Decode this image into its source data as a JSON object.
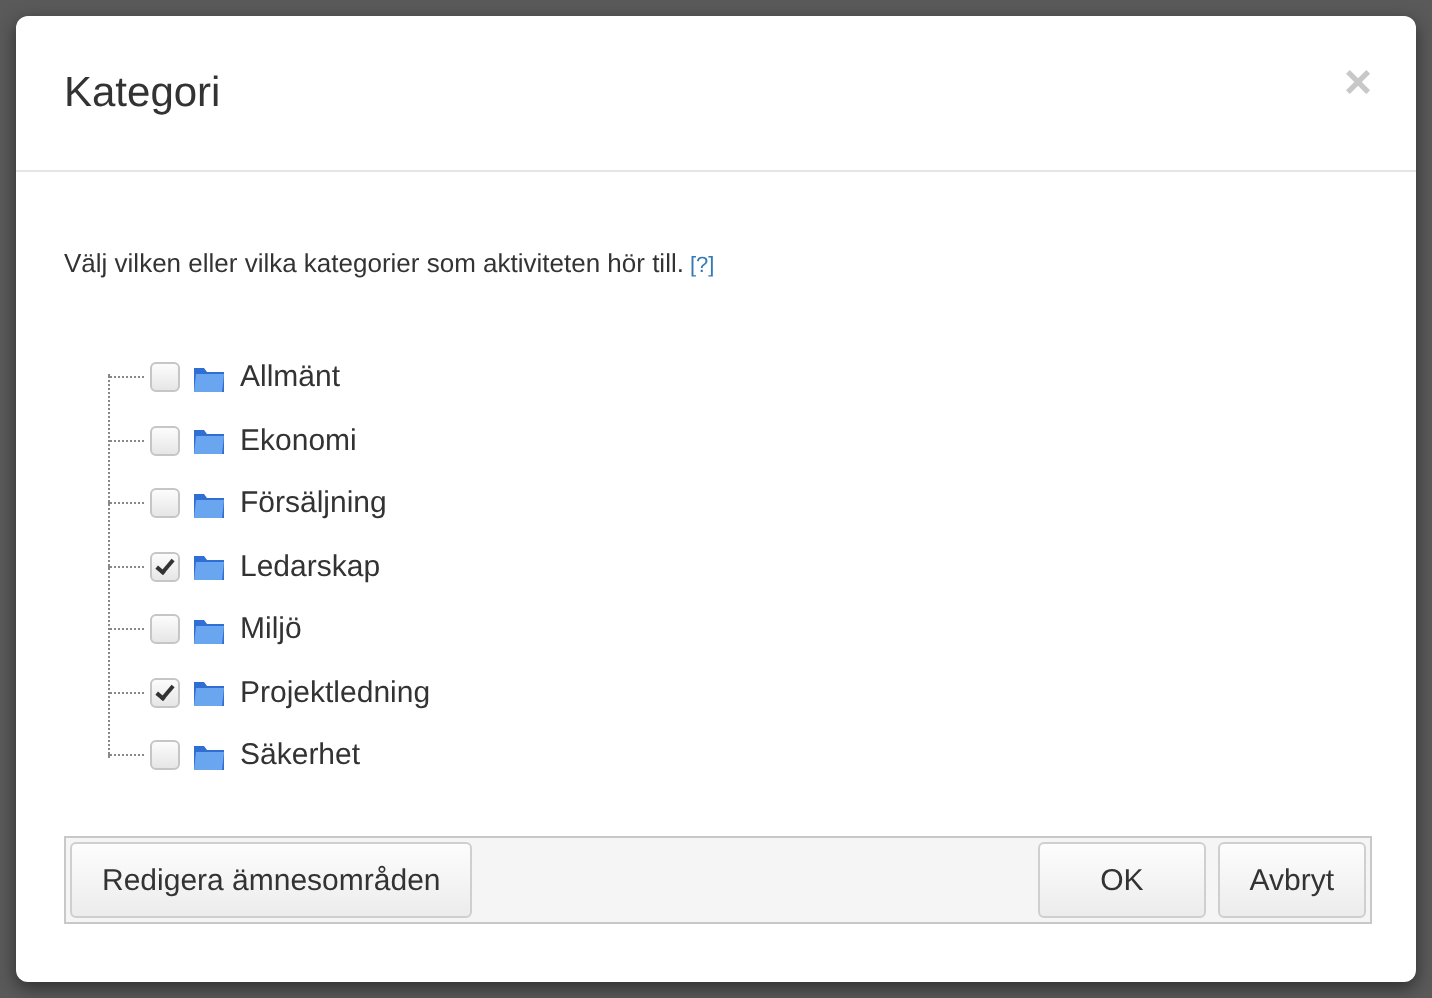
{
  "dialog": {
    "title": "Kategori",
    "close": "×"
  },
  "instruction": {
    "text": "Välj vilken eller vilka kategorier som aktiviteten hör till.",
    "help": "[?]"
  },
  "categories": [
    {
      "label": "Allmänt",
      "checked": false
    },
    {
      "label": "Ekonomi",
      "checked": false
    },
    {
      "label": "Försäljning",
      "checked": false
    },
    {
      "label": "Ledarskap",
      "checked": true
    },
    {
      "label": "Miljö",
      "checked": false
    },
    {
      "label": "Projektledning",
      "checked": true
    },
    {
      "label": "Säkerhet",
      "checked": false
    }
  ],
  "buttons": {
    "left": [
      "Redigera ämnesområden"
    ],
    "right": [
      "OK",
      "Avbryt"
    ]
  }
}
